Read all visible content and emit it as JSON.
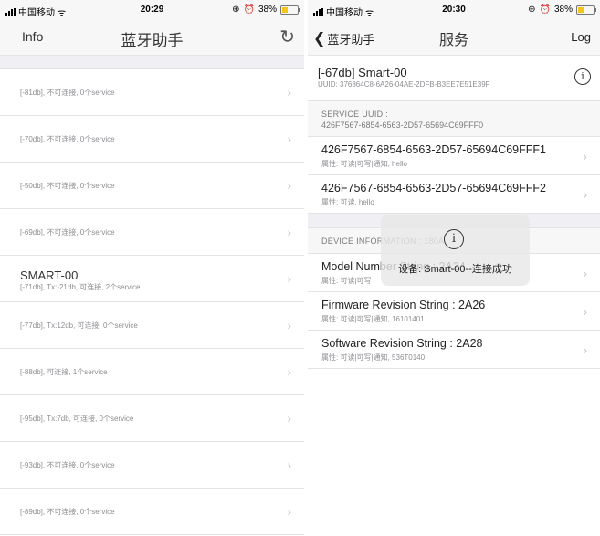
{
  "left": {
    "status": {
      "carrier": "中国移动",
      "time": "20:29",
      "battery": "38%",
      "battery_level": 0.38
    },
    "nav": {
      "left": "Info",
      "title": "蓝牙助手",
      "refresh_icon": "↻"
    },
    "devices": [
      {
        "name": "",
        "sub": "[-81db], 不可连接, 0个service"
      },
      {
        "name": "",
        "sub": "[-70db], 不可连接, 0个service"
      },
      {
        "name": "",
        "sub": "[-50db], 不可连接, 0个service"
      },
      {
        "name": "",
        "sub": "[-69db], 不可连接, 0个service"
      },
      {
        "name": "SMART-00",
        "sub": "[-71db], Tx:-21db, 可连接, 2个service"
      },
      {
        "name": "",
        "sub": "[-77db], Tx:12db, 可连接, 0个service"
      },
      {
        "name": "",
        "sub": "[-88db], 可连接, 1个service"
      },
      {
        "name": "",
        "sub": "[-95db], Tx:7db, 可连接, 0个service"
      },
      {
        "name": "",
        "sub": "[-93db], 不可连接, 0个service"
      },
      {
        "name": "",
        "sub": "[-89db], 不可连接, 0个service"
      }
    ]
  },
  "right": {
    "status": {
      "carrier": "中国移动",
      "time": "20:30",
      "battery": "38%",
      "battery_level": 0.38
    },
    "nav": {
      "back": "蓝牙助手",
      "title": "服务",
      "right": "Log"
    },
    "device": {
      "title": "[-67db] Smart-00",
      "uuid": "UUID: 376864C8-6A26-04AE-2DFB-B3EE7E51E39F"
    },
    "service_section": {
      "label": "SERVICE UUID :",
      "uuid": "426F7567-6854-6563-2D57-65694C69FFF0"
    },
    "characteristics": [
      {
        "name": "426F7567-6854-6563-2D57-65694C69FFF1",
        "props": "属性: 可读|可写|通知, hello"
      },
      {
        "name": "426F7567-6854-6563-2D57-65694C69FFF2",
        "props": "属性: 可读, hello"
      }
    ],
    "device_info_label": "DEVICE INFORMATION : 180A",
    "info_rows": [
      {
        "name": "Model Number String : 2A24",
        "props": "属性: 可读|可写"
      },
      {
        "name": "Firmware Revision String : 2A26",
        "props": "属性: 可读|可写|通知, 16101401"
      },
      {
        "name": "Software Revision String : 2A28",
        "props": "属性: 可读|可写|通知, 536T0140"
      }
    ],
    "toast": {
      "message": "设备: Smart-00--连接成功"
    }
  }
}
